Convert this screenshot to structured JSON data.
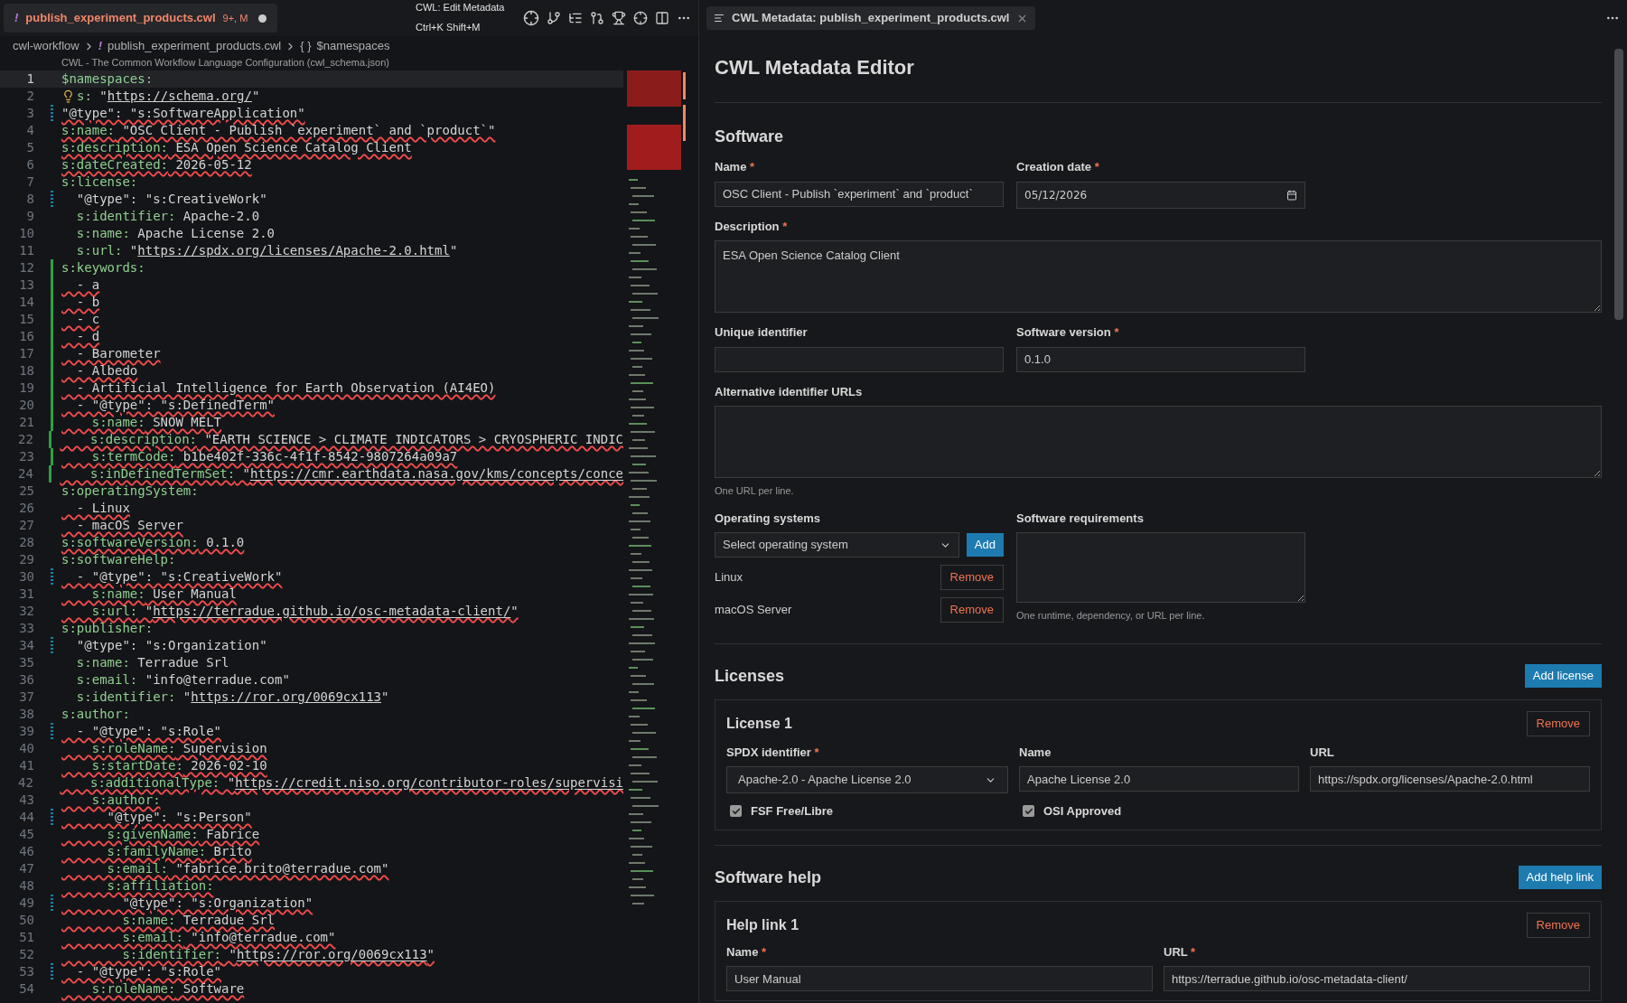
{
  "editor_tab": {
    "icon": "!",
    "label": "publish_experiment_products.cwl",
    "badge": "9+, M",
    "modified": true
  },
  "tooltip": {
    "title": "CWL: Edit Metadata",
    "shortcut": "Ctrl+K Shift+M"
  },
  "breadcrumbs": [
    {
      "label": "cwl-workflow"
    },
    {
      "label": "publish_experiment_products.cwl",
      "icon": "!"
    },
    {
      "label": "$namespaces",
      "icon": "{ }"
    }
  ],
  "codelens": "CWL - The Common Workflow Language Configuration (cwl_schema.json)",
  "code_lines": [
    {
      "number": "1",
      "key": "$namespaces:",
      "error": false,
      "added": false,
      "modified": false,
      "current": true
    },
    {
      "number": "2",
      "key": "s:",
      "value": " \"",
      "link": "https://schema.org/",
      "tail": "\"",
      "error": false,
      "added": false,
      "modified": false,
      "current": false,
      "bulb": true
    },
    {
      "number": "3",
      "value": "\"@type\": \"s:SoftwareApplication\"",
      "error": true,
      "added": false,
      "modified": true,
      "current": false
    },
    {
      "number": "4",
      "key": "s:name:",
      "value": " \"OSC Client - Publish `experiment` and `product`\"",
      "error": true,
      "added": false,
      "modified": false,
      "current": false
    },
    {
      "number": "5",
      "key": "s:description:",
      "value": " ESA Open Science Catalog Client",
      "error": true,
      "added": false,
      "modified": false,
      "current": false
    },
    {
      "number": "6",
      "key": "s:dateCreated:",
      "value": " 2026-05-12",
      "error": true,
      "added": false,
      "modified": false,
      "current": false
    },
    {
      "number": "7",
      "key": "s:license:",
      "error": false,
      "added": false,
      "modified": false,
      "current": false
    },
    {
      "number": "8",
      "value": "  \"@type\": \"s:CreativeWork\"",
      "error": false,
      "added": false,
      "modified": true,
      "current": false
    },
    {
      "number": "9",
      "key": "  s:identifier:",
      "value": " Apache-2.0",
      "error": false,
      "added": false,
      "modified": false,
      "current": false
    },
    {
      "number": "10",
      "key": "  s:name:",
      "value": " Apache License 2.0",
      "error": false,
      "added": false,
      "modified": false,
      "current": false
    },
    {
      "number": "11",
      "key": "  s:url:",
      "value": " \"",
      "link": "https://spdx.org/licenses/Apache-2.0.html",
      "tail": "\"",
      "error": false,
      "added": false,
      "modified": false,
      "current": false
    },
    {
      "number": "12",
      "key": "s:keywords:",
      "error": false,
      "added": true,
      "modified": false,
      "current": false
    },
    {
      "number": "13",
      "value": "  - a",
      "error": true,
      "added": true,
      "modified": false,
      "current": false
    },
    {
      "number": "14",
      "value": "  - b",
      "error": true,
      "added": true,
      "modified": false,
      "current": false
    },
    {
      "number": "15",
      "value": "  - c",
      "error": true,
      "added": true,
      "modified": false,
      "current": false
    },
    {
      "number": "16",
      "value": "  - d",
      "error": true,
      "added": true,
      "modified": false,
      "current": false
    },
    {
      "number": "17",
      "value": "  - Barometer",
      "error": true,
      "added": true,
      "modified": false,
      "current": false
    },
    {
      "number": "18",
      "value": "  - Albedo",
      "error": true,
      "added": true,
      "modified": false,
      "current": false
    },
    {
      "number": "19",
      "value": "  - Artificial Intelligence for Earth Observation (AI4EO)",
      "error": true,
      "added": true,
      "modified": false,
      "current": false
    },
    {
      "number": "20",
      "value": "  - \"@type\": \"s:DefinedTerm\"",
      "error": true,
      "added": true,
      "modified": false,
      "current": false
    },
    {
      "number": "21",
      "key": "    s:name:",
      "value": " SNOW MELT",
      "error": true,
      "added": true,
      "modified": false,
      "current": false
    },
    {
      "number": "22",
      "key": "    s:description:",
      "value": " \"EARTH SCIENCE > CLIMATE INDICATORS > CRYOSPHERIC INDIC",
      "error": true,
      "added": true,
      "modified": false,
      "current": false
    },
    {
      "number": "23",
      "key": "    s:termCode:",
      "value": " b1be402f-336c-4f1f-8542-9807264a09a7",
      "error": true,
      "added": true,
      "modified": false,
      "current": false
    },
    {
      "number": "24",
      "key": "    s:inDefinedTermSet:",
      "value": " \"",
      "link": "https://cmr.earthdata.nasa.gov/kms/concepts/conce",
      "error": true,
      "added": true,
      "modified": false,
      "current": false
    },
    {
      "number": "25",
      "key": "s:operatingSystem:",
      "error": false,
      "added": false,
      "modified": false,
      "current": false
    },
    {
      "number": "26",
      "value": "  - Linux",
      "error": true,
      "added": false,
      "modified": false,
      "current": false
    },
    {
      "number": "27",
      "value": "  - macOS Server",
      "error": true,
      "added": false,
      "modified": false,
      "current": false
    },
    {
      "number": "28",
      "key": "s:softwareVersion:",
      "value": " 0.1.0",
      "error": true,
      "added": false,
      "modified": false,
      "current": false
    },
    {
      "number": "29",
      "key": "s:softwareHelp:",
      "error": false,
      "added": false,
      "modified": false,
      "current": false
    },
    {
      "number": "30",
      "value": "  - \"@type\": \"s:CreativeWork\"",
      "error": true,
      "added": false,
      "modified": true,
      "current": false
    },
    {
      "number": "31",
      "key": "    s:name:",
      "value": " User Manual",
      "error": true,
      "added": false,
      "modified": false,
      "current": false
    },
    {
      "number": "32",
      "key": "    s:url:",
      "value": " \"",
      "link": "https://terradue.github.io/osc-metadata-client/",
      "tail": "\"",
      "error": true,
      "added": false,
      "modified": false,
      "current": false
    },
    {
      "number": "33",
      "key": "s:publisher:",
      "error": false,
      "added": false,
      "modified": false,
      "current": false
    },
    {
      "number": "34",
      "value": "  \"@type\": \"s:Organization\"",
      "error": false,
      "added": false,
      "modified": true,
      "current": false
    },
    {
      "number": "35",
      "key": "  s:name:",
      "value": " Terradue Srl",
      "error": false,
      "added": false,
      "modified": false,
      "current": false
    },
    {
      "number": "36",
      "key": "  s:email:",
      "value": " \"info@terradue.com\"",
      "error": false,
      "added": false,
      "modified": false,
      "current": false
    },
    {
      "number": "37",
      "key": "  s:identifier:",
      "value": " \"",
      "link": "https://ror.org/0069cx113",
      "tail": "\"",
      "error": false,
      "added": false,
      "modified": false,
      "current": false
    },
    {
      "number": "38",
      "key": "s:author:",
      "error": false,
      "added": false,
      "modified": false,
      "current": false
    },
    {
      "number": "39",
      "value": "  - \"@type\": \"s:Role\"",
      "error": true,
      "added": false,
      "modified": true,
      "current": false
    },
    {
      "number": "40",
      "key": "    s:roleName:",
      "value": " Supervision",
      "error": true,
      "added": false,
      "modified": false,
      "current": false
    },
    {
      "number": "41",
      "key": "    s:startDate:",
      "value": " 2026-02-10",
      "error": true,
      "added": false,
      "modified": false,
      "current": false
    },
    {
      "number": "42",
      "key": "    s:additionalType:",
      "value": " \"",
      "link": "https://credit.niso.org/contributor-roles/supervisi",
      "error": true,
      "added": false,
      "modified": false,
      "current": false
    },
    {
      "number": "43",
      "key": "    s:author:",
      "error": true,
      "added": false,
      "modified": false,
      "current": false
    },
    {
      "number": "44",
      "value": "      \"@type\": \"s:Person\"",
      "error": true,
      "added": false,
      "modified": true,
      "current": false
    },
    {
      "number": "45",
      "key": "      s:givenName:",
      "value": " Fabrice",
      "error": true,
      "added": false,
      "modified": false,
      "current": false
    },
    {
      "number": "46",
      "key": "      s:familyName:",
      "value": " Brito",
      "error": true,
      "added": false,
      "modified": false,
      "current": false
    },
    {
      "number": "47",
      "key": "      s:email:",
      "value": " \"fabrice.brito@terradue.com\"",
      "error": true,
      "added": false,
      "modified": false,
      "current": false
    },
    {
      "number": "48",
      "key": "      s:affiliation:",
      "error": true,
      "added": false,
      "modified": false,
      "current": false
    },
    {
      "number": "49",
      "value": "        \"@type\": \"s:Organization\"",
      "error": true,
      "added": false,
      "modified": true,
      "current": false
    },
    {
      "number": "50",
      "key": "        s:name:",
      "value": " Terradue Srl",
      "error": true,
      "added": false,
      "modified": false,
      "current": false
    },
    {
      "number": "51",
      "key": "        s:email:",
      "value": " \"info@terradue.com\"",
      "error": true,
      "added": false,
      "modified": false,
      "current": false
    },
    {
      "number": "52",
      "key": "        s:identifier:",
      "value": " \"",
      "link": "https://ror.org/0069cx113",
      "tail": "\"",
      "error": true,
      "added": false,
      "modified": false,
      "current": false
    },
    {
      "number": "53",
      "value": "  - \"@type\": \"s:Role\"",
      "error": true,
      "added": false,
      "modified": true,
      "current": false
    },
    {
      "number": "54",
      "key": "    s:roleName:",
      "value": " Software",
      "error": true,
      "added": false,
      "modified": false,
      "current": false
    }
  ],
  "panel_tab": {
    "label": "CWL Metadata: publish_experiment_products.cwl"
  },
  "metadata_editor": {
    "title": "CWL Metadata Editor",
    "software": {
      "heading": "Software",
      "name": {
        "label": "Name",
        "required_mark": "*",
        "value": "OSC Client - Publish `experiment` and `product`"
      },
      "creation_date": {
        "label": "Creation date",
        "required_mark": "*",
        "value": "05/12/2026"
      },
      "description": {
        "label": "Description",
        "required_mark": "*",
        "value": "ESA Open Science Catalog Client"
      },
      "unique_identifier": {
        "label": "Unique identifier"
      },
      "software_version": {
        "label": "Software version",
        "required_mark": "*",
        "value": "0.1.0"
      },
      "alternative_urls": {
        "label": "Alternative identifier URLs",
        "hint": "One URL per line."
      },
      "operating_systems": {
        "label": "Operating systems",
        "select": "Select operating system",
        "add_button": "Add",
        "items": [
          {
            "name": "Linux",
            "remove": "Remove"
          },
          {
            "name": "macOS Server",
            "remove": "Remove"
          }
        ]
      },
      "requirements": {
        "label": "Software requirements",
        "hint": "One runtime, dependency, or URL per line."
      }
    },
    "licenses": {
      "heading": "Licenses",
      "add_button": "Add license",
      "items": [
        {
          "title": "License 1",
          "remove": "Remove",
          "spdx": {
            "label": "SPDX identifier",
            "required_mark": "*",
            "value": "Apache-2.0 - Apache License 2.0"
          },
          "name": {
            "label": "Name",
            "value": "Apache License 2.0"
          },
          "url": {
            "label": "URL",
            "value": "https://spdx.org/licenses/Apache-2.0.html"
          },
          "flags": [
            {
              "label": "FSF Free/Libre",
              "checked": true
            },
            {
              "label": "OSI Approved",
              "checked": true
            }
          ]
        }
      ]
    },
    "software_help": {
      "heading": "Software help",
      "add_button": "Add help link",
      "items": [
        {
          "title": "Help link 1",
          "remove": "Remove",
          "name": {
            "label": "Name",
            "required_mark": "*",
            "value": "User Manual"
          },
          "url": {
            "label": "URL",
            "required_mark": "*",
            "value": "https://terradue.github.io/osc-metadata-client/"
          }
        }
      ]
    }
  }
}
